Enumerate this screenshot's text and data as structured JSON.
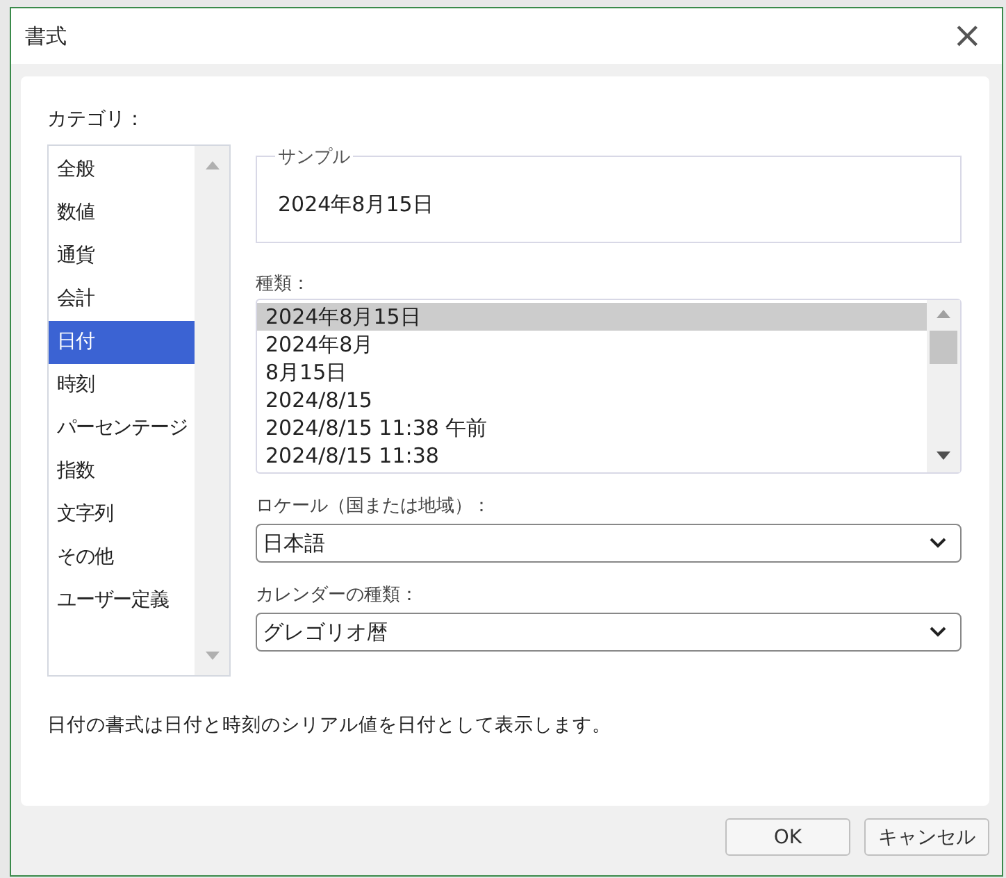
{
  "window": {
    "title": "書式",
    "close": "×"
  },
  "category": {
    "label": "カテゴリ：",
    "items": [
      {
        "label": "全般",
        "selected": false
      },
      {
        "label": "数値",
        "selected": false
      },
      {
        "label": "通貨",
        "selected": false
      },
      {
        "label": "会計",
        "selected": false
      },
      {
        "label": "日付",
        "selected": true
      },
      {
        "label": "時刻",
        "selected": false
      },
      {
        "label": "パーセンテージ",
        "selected": false
      },
      {
        "label": "指数",
        "selected": false
      },
      {
        "label": "文字列",
        "selected": false
      },
      {
        "label": "その他",
        "selected": false
      },
      {
        "label": "ユーザー定義",
        "selected": false
      }
    ]
  },
  "sample": {
    "legend": "サンプル",
    "value": "2024年8月15日"
  },
  "type": {
    "label": "種類：",
    "items": [
      {
        "label": "2024年8月15日",
        "selected": true
      },
      {
        "label": "2024年8月",
        "selected": false
      },
      {
        "label": "8月15日",
        "selected": false
      },
      {
        "label": "2024/8/15",
        "selected": false
      },
      {
        "label": "2024/8/15 11:38 午前",
        "selected": false
      },
      {
        "label": "2024/8/15 11:38",
        "selected": false
      }
    ]
  },
  "locale": {
    "label": "ロケール（国または地域）：",
    "value": "日本語"
  },
  "calendar": {
    "label": "カレンダーの種類：",
    "value": "グレゴリオ暦"
  },
  "description": "日付の書式は日付と時刻のシリアル値を日付として表示します。",
  "buttons": [
    "OK",
    "キャンセル"
  ]
}
